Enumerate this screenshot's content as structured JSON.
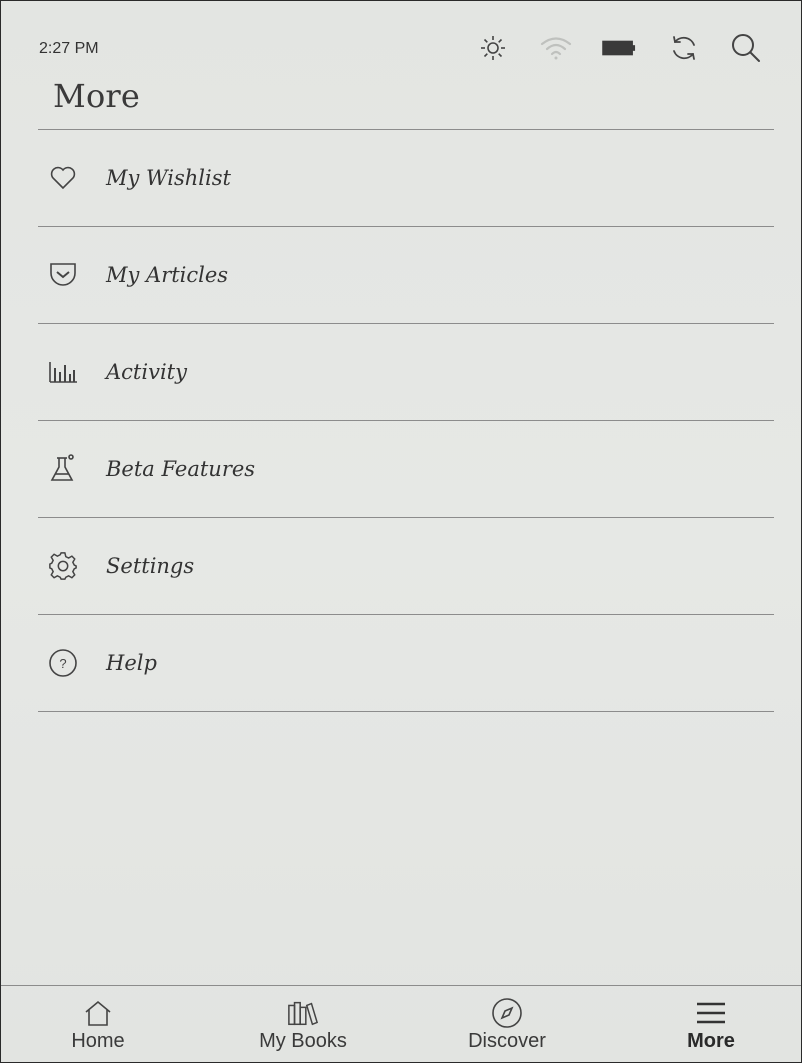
{
  "status_bar": {
    "time": "2:27 PM",
    "icons": [
      "brightness-icon",
      "wifi-icon",
      "battery-icon",
      "sync-icon",
      "search-icon"
    ]
  },
  "page": {
    "title": "More"
  },
  "menu": {
    "items": [
      {
        "label": "My Wishlist",
        "icon": "heart-icon"
      },
      {
        "label": "My Articles",
        "icon": "pocket-icon"
      },
      {
        "label": "Activity",
        "icon": "bar-chart-icon"
      },
      {
        "label": "Beta Features",
        "icon": "flask-icon"
      },
      {
        "label": "Settings",
        "icon": "gear-icon"
      },
      {
        "label": "Help",
        "icon": "help-icon"
      }
    ]
  },
  "bottom_nav": {
    "items": [
      {
        "label": "Home",
        "icon": "home-icon"
      },
      {
        "label": "My Books",
        "icon": "books-icon"
      },
      {
        "label": "Discover",
        "icon": "compass-icon"
      },
      {
        "label": "More",
        "icon": "menu-icon",
        "active": true
      }
    ]
  }
}
